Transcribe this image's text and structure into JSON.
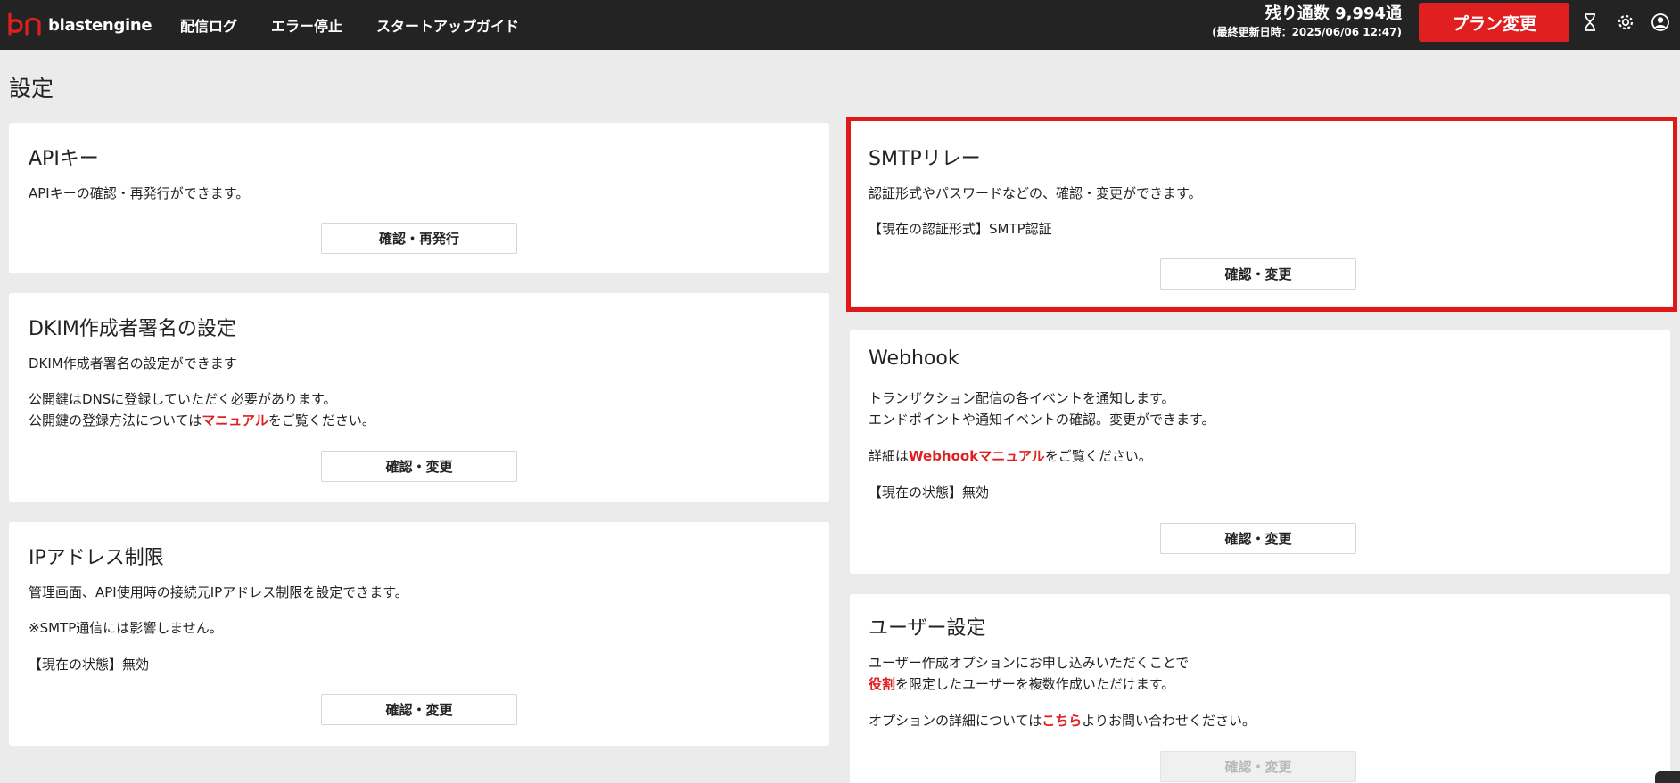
{
  "header": {
    "logo_text": "blastengine",
    "nav": [
      "配信ログ",
      "エラー停止",
      "スタートアップガイド"
    ],
    "remaining_main": "残り通数 9,994通",
    "remaining_sub": "(最終更新日時：2025/06/06 12:47)",
    "plan_button": "プラン変更",
    "icons": [
      "hourglass-icon",
      "gear-icon",
      "user-icon"
    ],
    "accent_color": "#e02020",
    "bar_color": "#232323"
  },
  "page": {
    "title": "設定"
  },
  "cards": {
    "api": {
      "title": "APIキー",
      "desc": "APIキーの確認・再発行ができます。",
      "button": "確認・再発行"
    },
    "dkim": {
      "title": "DKIM作成者署名の設定",
      "desc": "DKIM作成者署名の設定ができます",
      "line1": "公開鍵はDNSに登録していただく必要があります。",
      "line2_pre": "公開鍵の登録方法については",
      "line2_link": "マニュアル",
      "line2_post": "をご覧ください。",
      "button": "確認・変更"
    },
    "ip": {
      "title": "IPアドレス制限",
      "desc": "管理画面、API使用時の接続元IPアドレス制限を設定できます。",
      "note": "※SMTP通信には影響しません。",
      "status": "【現在の状態】無効",
      "button": "確認・変更"
    },
    "smtp": {
      "title": "SMTPリレー",
      "desc": "認証形式やパスワードなどの、確認・変更ができます。",
      "status": "【現在の認証形式】SMTP認証",
      "button": "確認・変更"
    },
    "webhook": {
      "title": "Webhook",
      "line1": "トランザクション配信の各イベントを通知します。",
      "line2": "エンドポイントや通知イベントの確認。変更ができます。",
      "detail_pre": "詳細は",
      "detail_link": "Webhookマニュアル",
      "detail_post": "をご覧ください。",
      "status": "【現在の状態】無効",
      "button": "確認・変更"
    },
    "user": {
      "title": "ユーザー設定",
      "line1": "ユーザー作成オプションにお申し込みいただくことで",
      "line2_link": "役割",
      "line2_post": "を限定したユーザーを複数作成いただけます。",
      "option_pre": "オプションの詳細については",
      "option_link": "こちら",
      "option_post": "よりお問い合わせください。",
      "button": "確認・変更"
    }
  }
}
